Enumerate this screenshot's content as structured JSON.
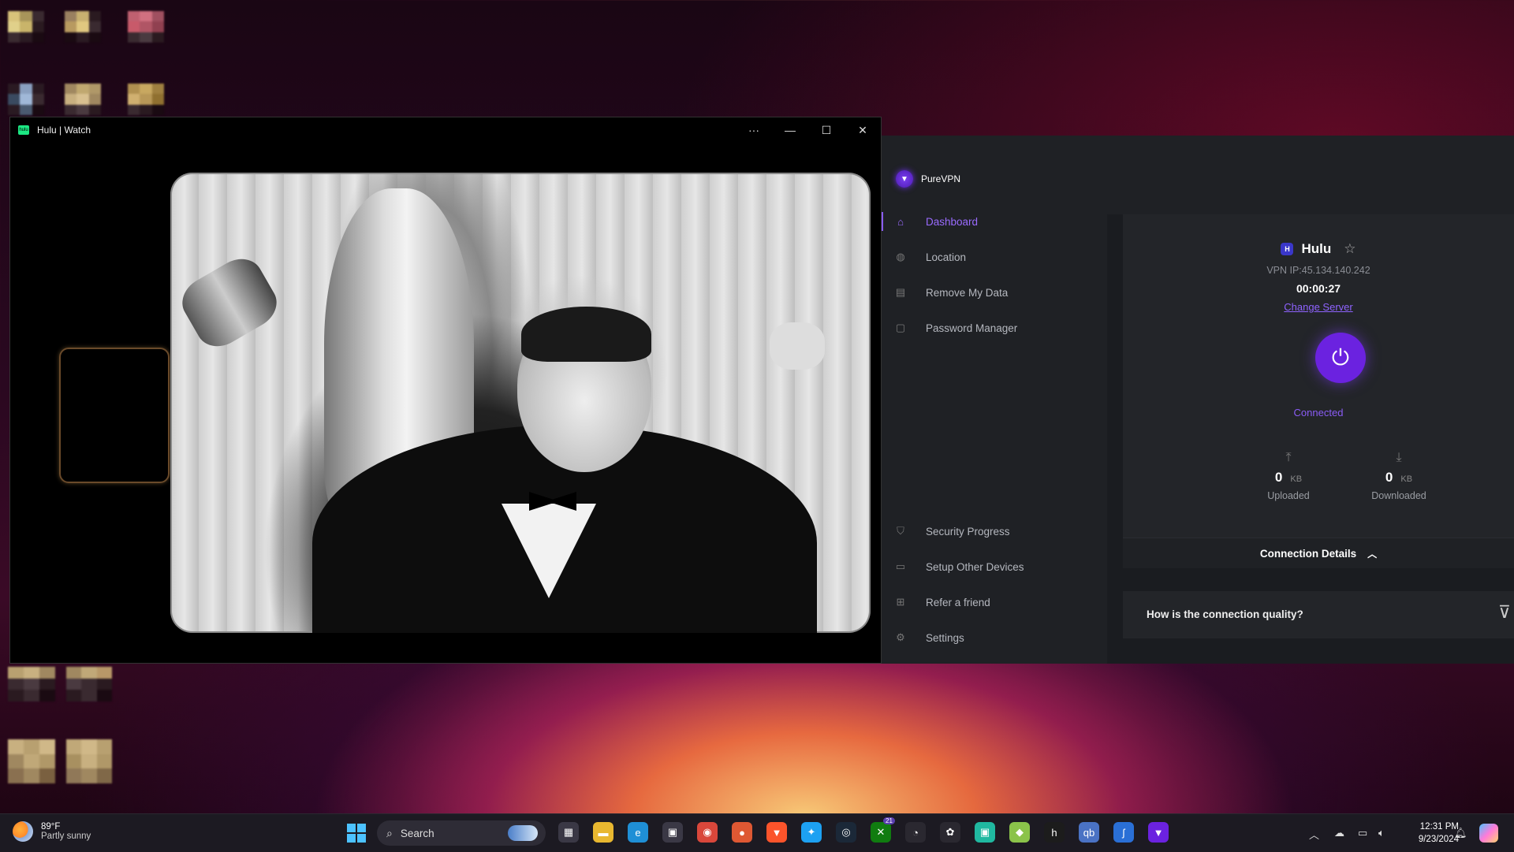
{
  "hulu_window": {
    "title": "Hulu | Watch",
    "favicon_text": "hulu",
    "controls": [
      "···",
      "—",
      "☐",
      "✕"
    ]
  },
  "vpn": {
    "app_name": "PureVPN",
    "nav_top": [
      {
        "label": "Dashboard",
        "icon": "home-icon",
        "glyph": "⌂",
        "active": true
      },
      {
        "label": "Location",
        "icon": "globe-icon",
        "glyph": "◍"
      },
      {
        "label": "Remove My Data",
        "icon": "data-icon",
        "glyph": "▤"
      },
      {
        "label": "Password Manager",
        "icon": "lock-icon",
        "glyph": "▢"
      }
    ],
    "nav_bottom": [
      {
        "label": "Security Progress",
        "icon": "shield-icon",
        "glyph": "⛉"
      },
      {
        "label": "Setup Other Devices",
        "icon": "devices-icon",
        "glyph": "▭"
      },
      {
        "label": "Refer a friend",
        "icon": "gift-icon",
        "glyph": "⊞"
      },
      {
        "label": "Settings",
        "icon": "gear-icon",
        "glyph": "⚙"
      }
    ],
    "service": {
      "badge": "H",
      "name": "Hulu"
    },
    "vpn_ip": "VPN IP:45.134.140.242",
    "timer": "00:00:27",
    "change_server": "Change Server",
    "status": "Connected",
    "uploaded": {
      "value": "0",
      "unit": "KB",
      "label": "Uploaded"
    },
    "downloaded": {
      "value": "0",
      "unit": "KB",
      "label": "Downloaded"
    },
    "connection_details": "Connection Details",
    "quality_question": "How is the connection quality?"
  },
  "taskbar": {
    "weather_temp": "89°F",
    "weather_desc": "Partly sunny",
    "search_label": "Search",
    "time": "12:31 PM",
    "date": "9/23/2024",
    "badge_count": "21",
    "apps": [
      {
        "name": "task-view-icon",
        "glyph": "▦",
        "color": "#3a3845"
      },
      {
        "name": "file-explorer-icon",
        "glyph": "▬",
        "color": "#e8b730"
      },
      {
        "name": "edge-icon",
        "glyph": "e",
        "color": "#1f8fd6"
      },
      {
        "name": "store-icon",
        "glyph": "▣",
        "color": "#3a3845"
      },
      {
        "name": "chrome-icon",
        "glyph": "◉",
        "color": "#d9473b"
      },
      {
        "name": "duckduckgo-icon",
        "glyph": "●",
        "color": "#de5833"
      },
      {
        "name": "brave-icon",
        "glyph": "▼",
        "color": "#fb542b"
      },
      {
        "name": "twitter-icon",
        "glyph": "✦",
        "color": "#1da1f2"
      },
      {
        "name": "steam-icon",
        "glyph": "◎",
        "color": "#1b2838"
      },
      {
        "name": "xbox-icon",
        "glyph": "✕",
        "color": "#107c10"
      },
      {
        "name": "speedometer-icon",
        "glyph": "◔",
        "color": "#2a2830"
      },
      {
        "name": "photos-icon",
        "glyph": "✿",
        "color": "#2a2830"
      },
      {
        "name": "android-icon",
        "glyph": "▣",
        "color": "#20b8a0"
      },
      {
        "name": "package-icon",
        "glyph": "◆",
        "color": "#8bc34a"
      },
      {
        "name": "hulu-app-icon",
        "glyph": "h",
        "color": "#1c1c1c"
      },
      {
        "name": "qbittorrent-icon",
        "glyph": "qb",
        "color": "#4a72c4"
      },
      {
        "name": "sling-icon",
        "glyph": "ʃ",
        "color": "#2a6fd6"
      },
      {
        "name": "purevpn-app-icon",
        "glyph": "▼",
        "color": "#6b22e0"
      }
    ]
  }
}
